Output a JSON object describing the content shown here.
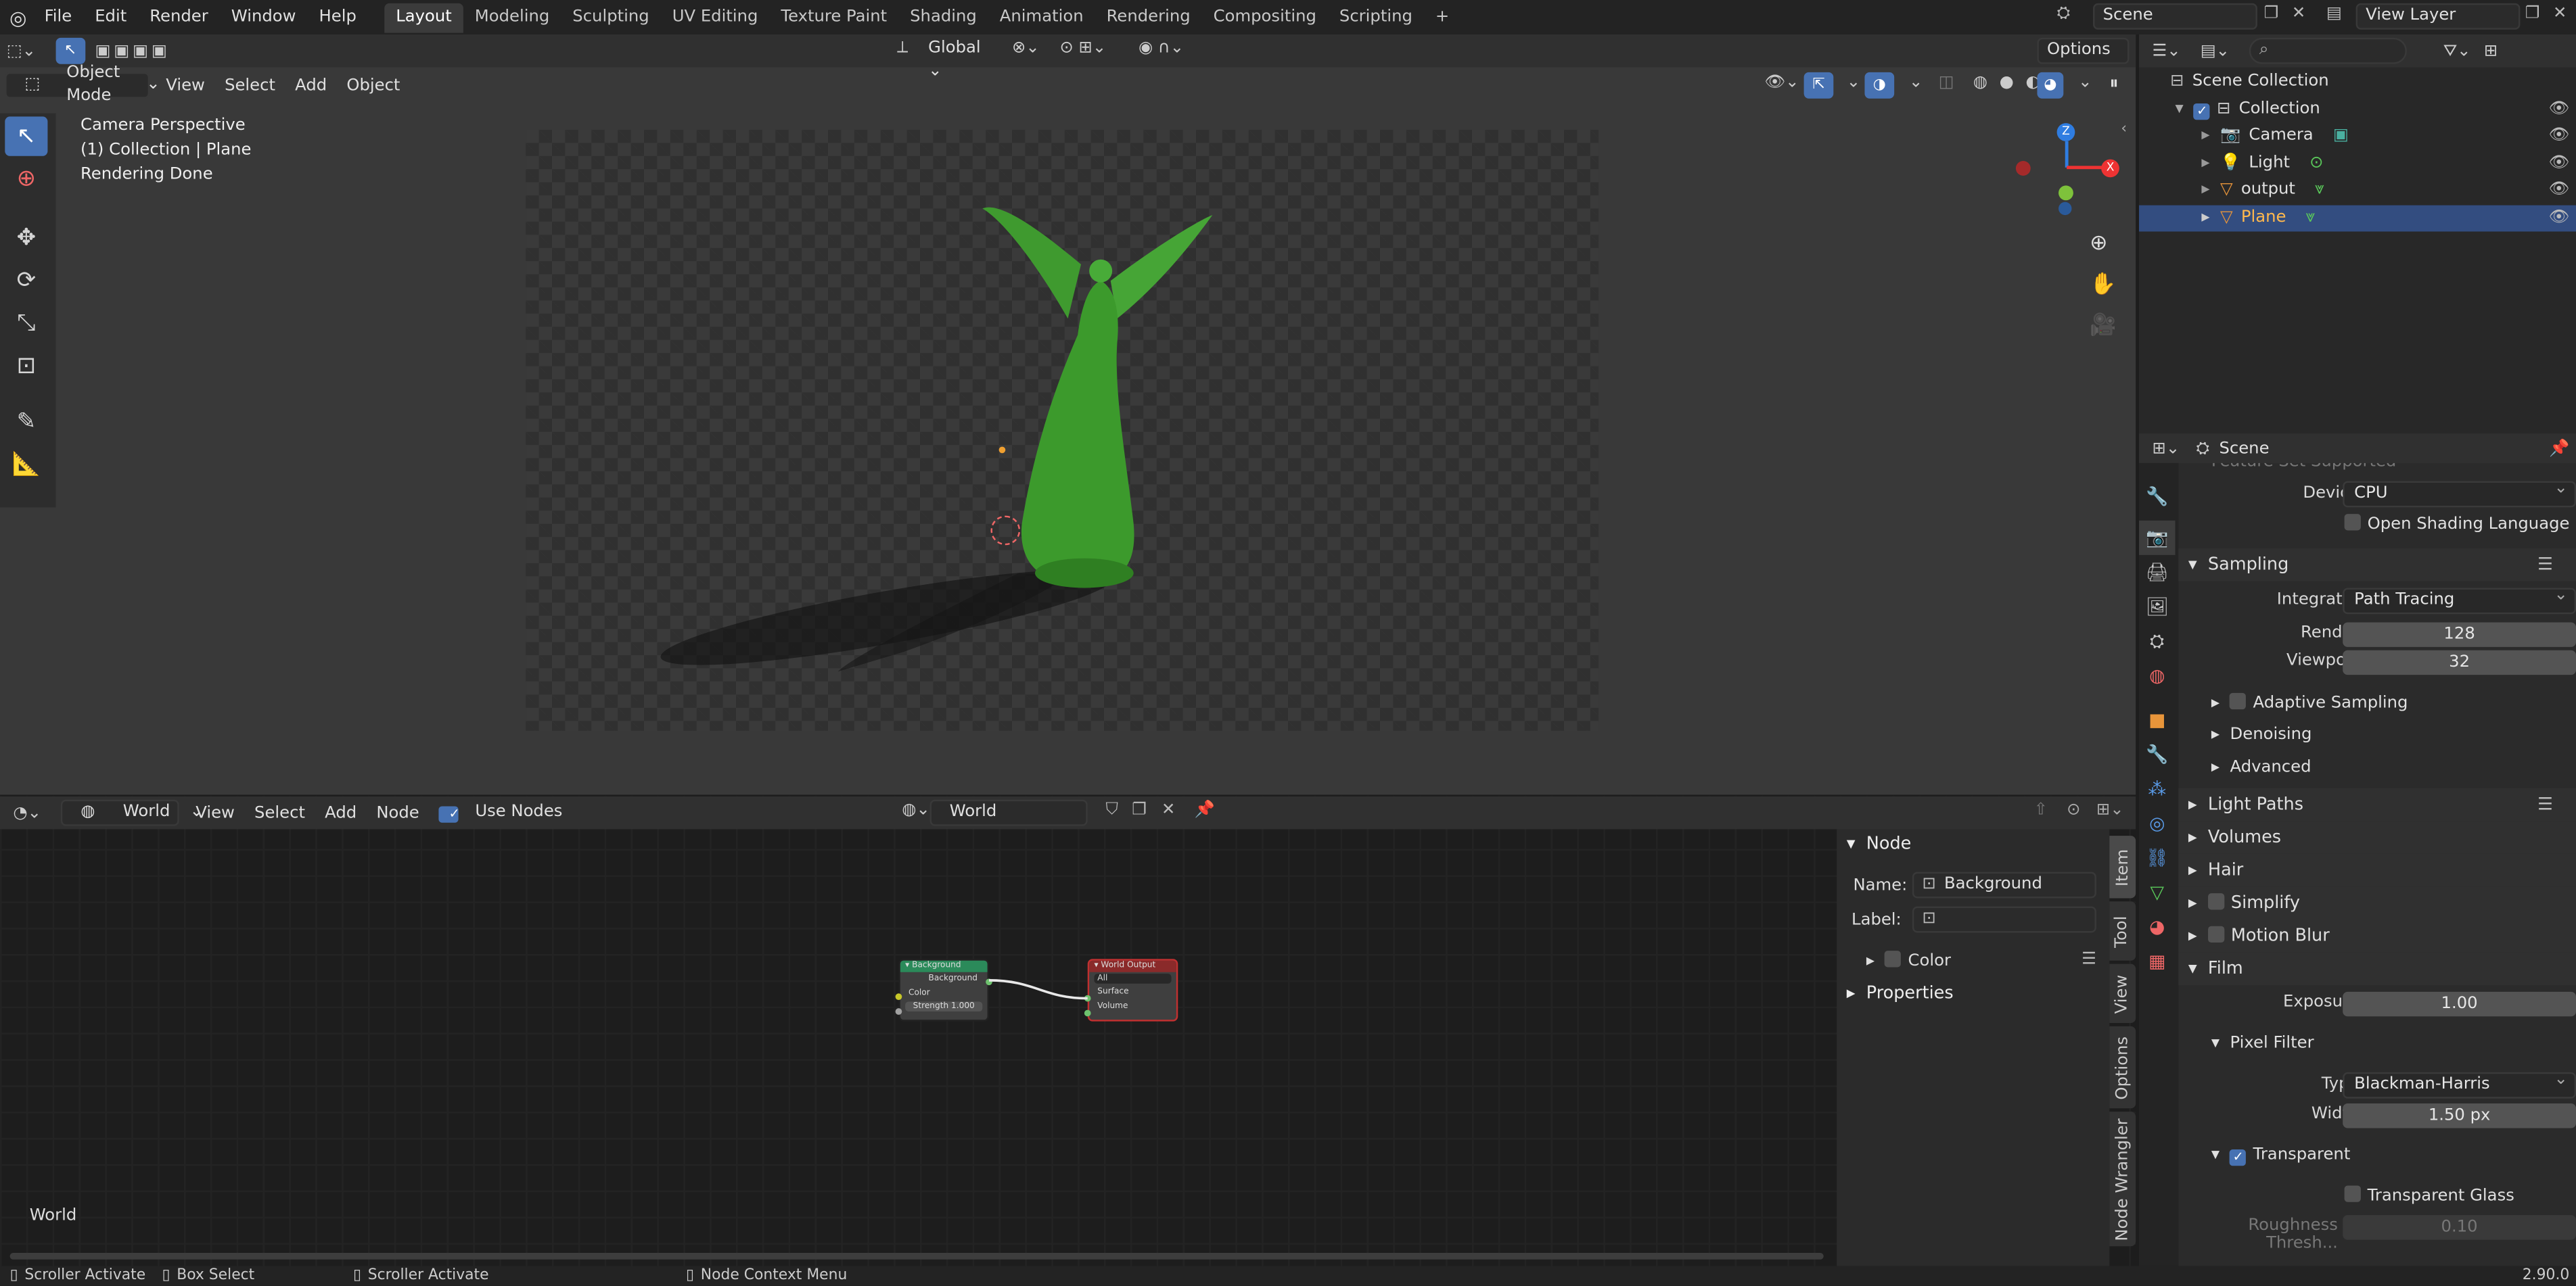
{
  "topbar": {
    "menus": [
      "File",
      "Edit",
      "Render",
      "Window",
      "Help"
    ],
    "workspaces": [
      "Layout",
      "Modeling",
      "Sculpting",
      "UV Editing",
      "Texture Paint",
      "Shading",
      "Animation",
      "Rendering",
      "Compositing",
      "Scripting"
    ],
    "add_tab": "+",
    "scene": "Scene",
    "view_layer": "View Layer"
  },
  "viewport_header": {
    "orientation": "Global",
    "options": "Options",
    "mode": "Object Mode",
    "menus": [
      "View",
      "Select",
      "Add",
      "Object"
    ]
  },
  "viewport": {
    "overlay_lines": [
      "Camera Perspective",
      "(1) Collection | Plane",
      "Rendering Done"
    ],
    "gizmo": {
      "z": "Z",
      "x": "X"
    }
  },
  "outliner": {
    "search_placeholder": "",
    "root": "Scene Collection",
    "collection": "Collection",
    "items": [
      {
        "name": "Camera"
      },
      {
        "name": "Light"
      },
      {
        "name": "output"
      },
      {
        "name": "Plane"
      }
    ]
  },
  "properties": {
    "context": "Scene",
    "cut_top": "Feature Set     Supported",
    "device_label": "Device",
    "device_value": "CPU",
    "osl": "Open Shading Language",
    "sampling": "Sampling",
    "integrator_label": "Integrator",
    "integrator_value": "Path Tracing",
    "render_label": "Render",
    "render_value": "128",
    "viewport_label": "Viewport",
    "viewport_value": "32",
    "adaptive": "Adaptive Sampling",
    "denoising": "Denoising",
    "advanced": "Advanced",
    "light_paths": "Light Paths",
    "volumes": "Volumes",
    "hair": "Hair",
    "simplify": "Simplify",
    "motion_blur": "Motion Blur",
    "film": "Film",
    "exposure_label": "Exposure",
    "exposure_value": "1.00",
    "pixel_filter": "Pixel Filter",
    "type_label": "Type",
    "type_value": "Blackman-Harris",
    "width_label": "Width",
    "width_value": "1.50 px",
    "transparent": "Transparent",
    "transparent_glass": "Transparent Glass",
    "roughness_label": "Roughness Thresh...",
    "roughness_value": "0.10"
  },
  "node_editor": {
    "shader_type": "World",
    "menus": [
      "View",
      "Select",
      "Add",
      "Node"
    ],
    "use_nodes": "Use Nodes",
    "world_name": "World",
    "corner_label": "World",
    "background_node": {
      "title": "Background",
      "output": "Background",
      "in_color": "Color",
      "strength": "Strength  1.000"
    },
    "output_node": {
      "title": "World Output",
      "target": "All",
      "surface": "Surface",
      "volume": "Volume"
    }
  },
  "sidebar": {
    "section": "Node",
    "name_label": "Name:",
    "name_value": "Background",
    "label_label": "Label:",
    "label_value": "",
    "color": "Color",
    "properties": "Properties",
    "tabs": [
      "Item",
      "Tool",
      "View",
      "Options",
      "Node Wrangler"
    ]
  },
  "statusbar": {
    "items": [
      "Scroller Activate",
      "Box Select",
      "Scroller Activate",
      "Node Context Menu"
    ],
    "version": "2.90.0"
  }
}
